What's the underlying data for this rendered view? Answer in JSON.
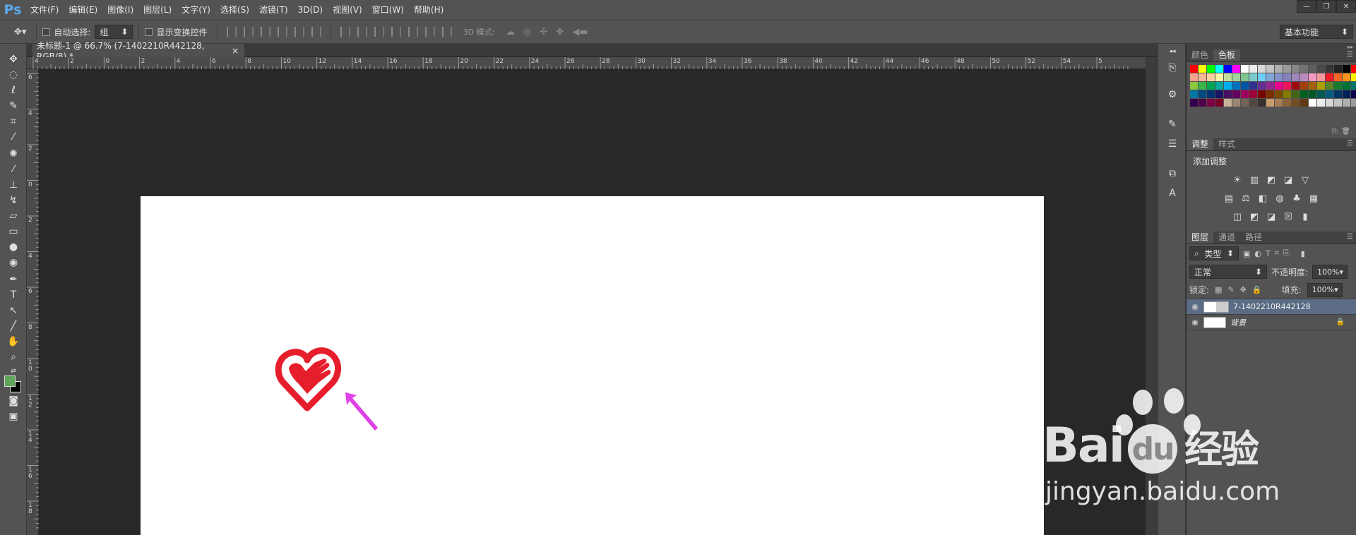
{
  "app": {
    "logo": "Ps"
  },
  "menu": [
    "文件(F)",
    "编辑(E)",
    "图像(I)",
    "图层(L)",
    "文字(Y)",
    "选择(S)",
    "滤镜(T)",
    "3D(D)",
    "视图(V)",
    "窗口(W)",
    "帮助(H)"
  ],
  "window_controls": {
    "minimize": "—",
    "restore": "❐",
    "close": "✕"
  },
  "options": {
    "auto_select_label": "自动选择:",
    "auto_select_value": "组",
    "show_transform_label": "显示变换控件",
    "mode3d_label": "3D 模式:",
    "workspace": "基本功能"
  },
  "document_tab": {
    "title": "未标题-1 @ 66.7% (7-1402210R442128, RGB/8) *",
    "close": "×"
  },
  "ruler_h": [
    "4",
    "2",
    "0",
    "2",
    "4",
    "6",
    "8",
    "10",
    "12",
    "14",
    "16",
    "18",
    "20",
    "22",
    "24",
    "26",
    "28",
    "30",
    "32",
    "34",
    "36",
    "38",
    "40",
    "42",
    "44",
    "46",
    "48",
    "50",
    "52",
    "54",
    "5"
  ],
  "ruler_v": [
    "6",
    "4",
    "2",
    "0",
    "2",
    "4",
    "6",
    "8",
    "1 0",
    "1 2",
    "1 4",
    "1 6",
    "1 8"
  ],
  "color_panel": {
    "tabs": [
      "颜色",
      "色板"
    ],
    "active": 1
  },
  "swatches": {
    "colors": [
      "#ff0000",
      "#ffff00",
      "#00ff00",
      "#00ffff",
      "#0000ff",
      "#ff00ff",
      "#ffffff",
      "#ebebeb",
      "#d7d7d7",
      "#c3c3c3",
      "#afafaf",
      "#9b9b9b",
      "#878787",
      "#737373",
      "#5f5f5f",
      "#4b4b4b",
      "#373737",
      "#232323",
      "#000000",
      "#ff0000",
      "#f3a38f",
      "#f7b795",
      "#fbd09e",
      "#fff7a5",
      "#c4df9b",
      "#a3d39c",
      "#7dc68e",
      "#7ccccc",
      "#6ecff6",
      "#7ea6d8",
      "#8393ca",
      "#8781bd",
      "#a186be",
      "#bd8cbf",
      "#f49ac1",
      "#f5989d",
      "#ed1c24",
      "#f26522",
      "#f7941d",
      "#fff200",
      "#8dc63f",
      "#39b54a",
      "#00a651",
      "#00a99d",
      "#00aeef",
      "#0072bc",
      "#0054a6",
      "#2e3192",
      "#662d91",
      "#92278f",
      "#ec008c",
      "#ed145b",
      "#9e0b0f",
      "#a0410d",
      "#a3620a",
      "#aba000",
      "#598527",
      "#197b30",
      "#007236",
      "#00746b",
      "#0076a3",
      "#004a80",
      "#003471",
      "#1b1464",
      "#440e62",
      "#630460",
      "#9e005d",
      "#9e0039",
      "#790000",
      "#7b2e00",
      "#7d4900",
      "#827b00",
      "#406618",
      "#005e20",
      "#005826",
      "#005952",
      "#005b7f",
      "#003663",
      "#002157",
      "#0d004c",
      "#32004b",
      "#4b0049",
      "#7b0046",
      "#7a0026",
      "#c7b299",
      "#998675",
      "#736357",
      "#534741",
      "#37302d",
      "#c69c6d",
      "#a67c52",
      "#8c6239",
      "#754c24",
      "#603913",
      "#ffffff",
      "#ebebeb",
      "#d7d7d7",
      "#c3c3c3",
      "#afafaf",
      "#9b9b9b"
    ]
  },
  "adjustments": {
    "tabs": [
      "调整",
      "样式"
    ],
    "title": "添加调整",
    "row1": [
      "☀",
      "▥",
      "◩",
      "◪",
      "▽"
    ],
    "row2": [
      "▤",
      "⚖",
      "◧",
      "◍",
      "♣",
      "▦"
    ],
    "row3": [
      "◫",
      "◩",
      "◪",
      "☒",
      "▮"
    ]
  },
  "layers_panel": {
    "tabs": [
      "图层",
      "通道",
      "路径"
    ],
    "filter_kind": "类型",
    "blend_mode": "正常",
    "opacity_label": "不透明度:",
    "opacity_value": "100%",
    "lock_label": "锁定:",
    "fill_label": "填充:",
    "fill_value": "100%",
    "layers": [
      {
        "name": "7-1402210R442128",
        "selected": true
      },
      {
        "name": "背景",
        "selected": false
      }
    ]
  },
  "watermark": {
    "brand_left": "Bai",
    "brand_mid": "du",
    "brand_right": "经验",
    "url": "jingyan.baidu.com"
  },
  "colors": {
    "heart": "#e61e2c",
    "arrow": "#e040e8",
    "fg_swatch": "#5fa55a"
  }
}
